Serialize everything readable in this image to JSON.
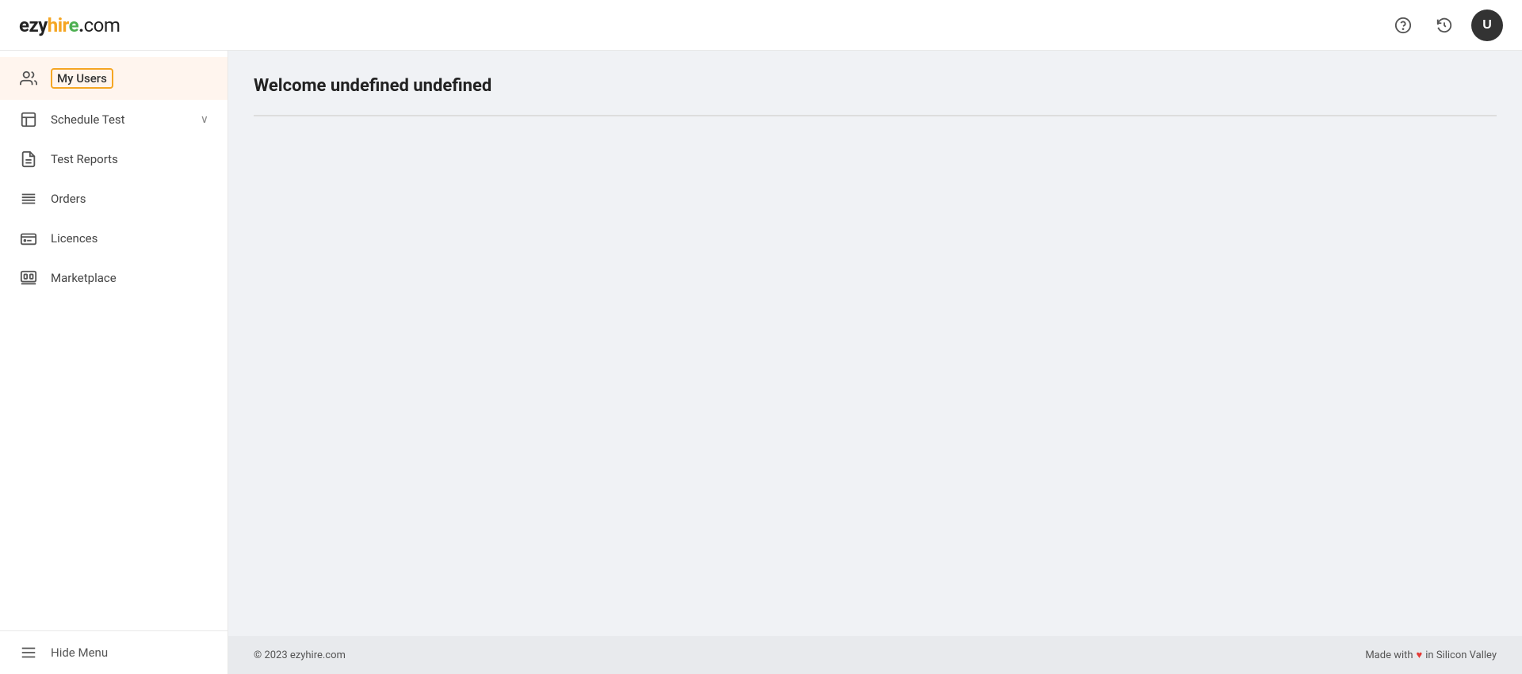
{
  "header": {
    "logo": {
      "ezy": "ezy",
      "hire": "hir",
      "e_colored": "e",
      "dot": ".",
      "com": "com"
    },
    "help_icon": "?",
    "history_icon": "⏱",
    "avatar_label": "U"
  },
  "sidebar": {
    "items": [
      {
        "id": "my-users",
        "label": "My Users",
        "icon": "users",
        "active": true,
        "has_chevron": false
      },
      {
        "id": "schedule-test",
        "label": "Schedule Test",
        "icon": "schedule",
        "active": false,
        "has_chevron": true
      },
      {
        "id": "test-reports",
        "label": "Test Reports",
        "icon": "report",
        "active": false,
        "has_chevron": false
      },
      {
        "id": "orders",
        "label": "Orders",
        "icon": "orders",
        "active": false,
        "has_chevron": false
      },
      {
        "id": "licences",
        "label": "Licences",
        "icon": "licences",
        "active": false,
        "has_chevron": false
      },
      {
        "id": "marketplace",
        "label": "Marketplace",
        "icon": "marketplace",
        "active": false,
        "has_chevron": false
      }
    ],
    "footer": {
      "hide_menu_label": "Hide Menu"
    }
  },
  "content": {
    "welcome_title": "Welcome undefined undefined"
  },
  "footer": {
    "copyright": "© 2023 ezyhire.com",
    "made_with_prefix": "Made with",
    "made_with_suffix": "in Silicon Valley"
  }
}
